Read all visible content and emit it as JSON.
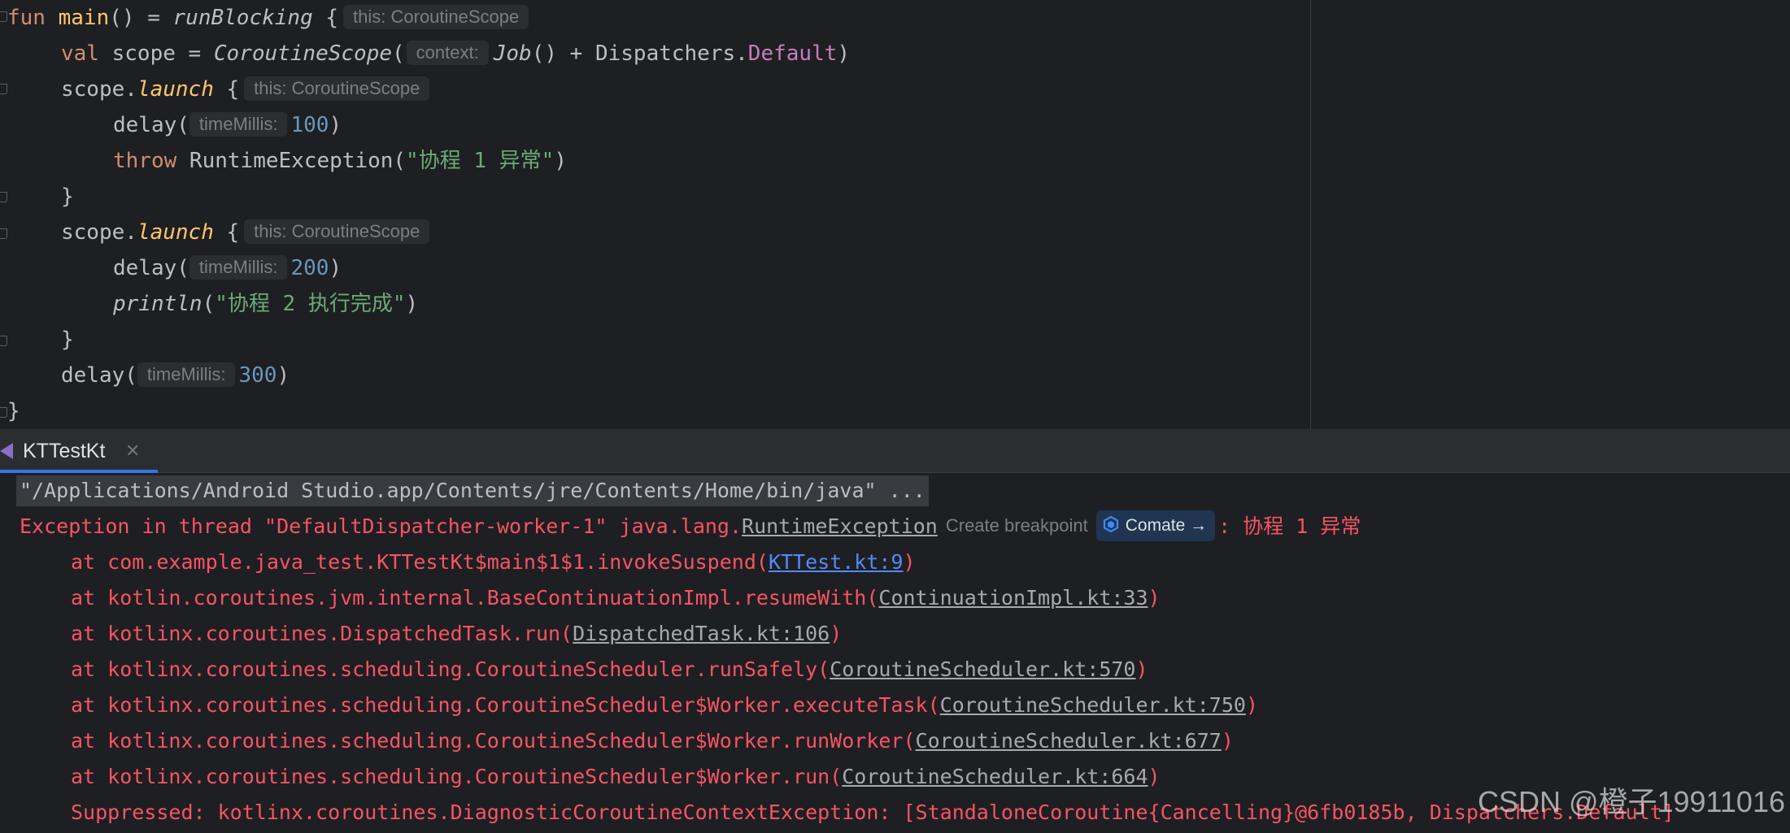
{
  "editor": {
    "line1": {
      "kw": "fun",
      "fn": "main",
      "mid": "() = ",
      "call": "runBlocking",
      "brace": " {",
      "hint": "this: CoroutineScope"
    },
    "line2": {
      "kw": "val",
      "name": " scope = ",
      "cls": "CoroutineScope",
      "paren": "(",
      "hint": "context:",
      "job": "Job",
      "rest": "() + Dispatchers.",
      "prop": "Default",
      "close": ")"
    },
    "line3": {
      "recv": "scope.",
      "call": "launch",
      "brace": " {",
      "hint": "this: CoroutineScope"
    },
    "line4": {
      "fn": "delay(",
      "hint": "timeMillis:",
      "num": "100",
      "close": ")"
    },
    "line5": {
      "kw": "throw",
      "cls": " RuntimeException(",
      "str": "\"协程 1 异常\"",
      "close": ")"
    },
    "line6": {
      "brace": "}"
    },
    "line7": {
      "recv": "scope.",
      "call": "launch",
      "brace": " {",
      "hint": "this: CoroutineScope"
    },
    "line8": {
      "fn": "delay(",
      "hint": "timeMillis:",
      "num": "200",
      "close": ")"
    },
    "line9": {
      "call": "println",
      "paren": "(",
      "str": "\"协程 2 执行完成\"",
      "close": ")"
    },
    "line10": {
      "brace": "}"
    },
    "line11": {
      "fn": "delay(",
      "hint": "timeMillis:",
      "num": "300",
      "close": ")"
    },
    "line12": {
      "brace": "}"
    }
  },
  "run_panel": {
    "tab_label": "KTTestKt",
    "close_glyph": "✕",
    "command": "\"/Applications/Android Studio.app/Contents/jre/Contents/Home/bin/java\" ...",
    "exception_prefix": "Exception in thread \"DefaultDispatcher-worker-1\" java.lang.",
    "exception_class": "RuntimeException",
    "create_breakpoint": "Create breakpoint",
    "comate_label": "Comate →",
    "exception_suffix": ": 协程 1 异常",
    "stack": [
      {
        "prefix": "at com.example.java_test.KTTestKt$main$1$1.invokeSuspend(",
        "link": "KTTest.kt:9",
        "suffix": ")"
      },
      {
        "prefix": "at kotlin.coroutines.jvm.internal.BaseContinuationImpl.resumeWith(",
        "link": "ContinuationImpl.kt:33",
        "suffix": ")"
      },
      {
        "prefix": "at kotlinx.coroutines.DispatchedTask.run(",
        "link": "DispatchedTask.kt:106",
        "suffix": ")"
      },
      {
        "prefix": "at kotlinx.coroutines.scheduling.CoroutineScheduler.runSafely(",
        "link": "CoroutineScheduler.kt:570",
        "suffix": ")"
      },
      {
        "prefix": "at kotlinx.coroutines.scheduling.CoroutineScheduler$Worker.executeTask(",
        "link": "CoroutineScheduler.kt:750",
        "suffix": ")"
      },
      {
        "prefix": "at kotlinx.coroutines.scheduling.CoroutineScheduler$Worker.runWorker(",
        "link": "CoroutineScheduler.kt:677",
        "suffix": ")"
      },
      {
        "prefix": "at kotlinx.coroutines.scheduling.CoroutineScheduler$Worker.run(",
        "link": "CoroutineScheduler.kt:664",
        "suffix": ")"
      }
    ],
    "suppressed": "Suppressed: kotlinx.coroutines.DiagnosticCoroutineContextException: [StandaloneCoroutine{Cancelling}@6fb0185b, Dispatchers.Default]"
  },
  "watermark": "CSDN @橙子19911016",
  "colors": {
    "background": "#1e1f22",
    "keyword": "#cf8e6d",
    "string": "#6aab73",
    "number": "#6897bb",
    "error_text": "#f75464",
    "link_blue": "#548af7",
    "tab_underline": "#3574f0"
  },
  "icons": {
    "run_tab": "run-config-icon",
    "comate": "comate-cube-icon",
    "fold": "fold-marker-icon"
  }
}
